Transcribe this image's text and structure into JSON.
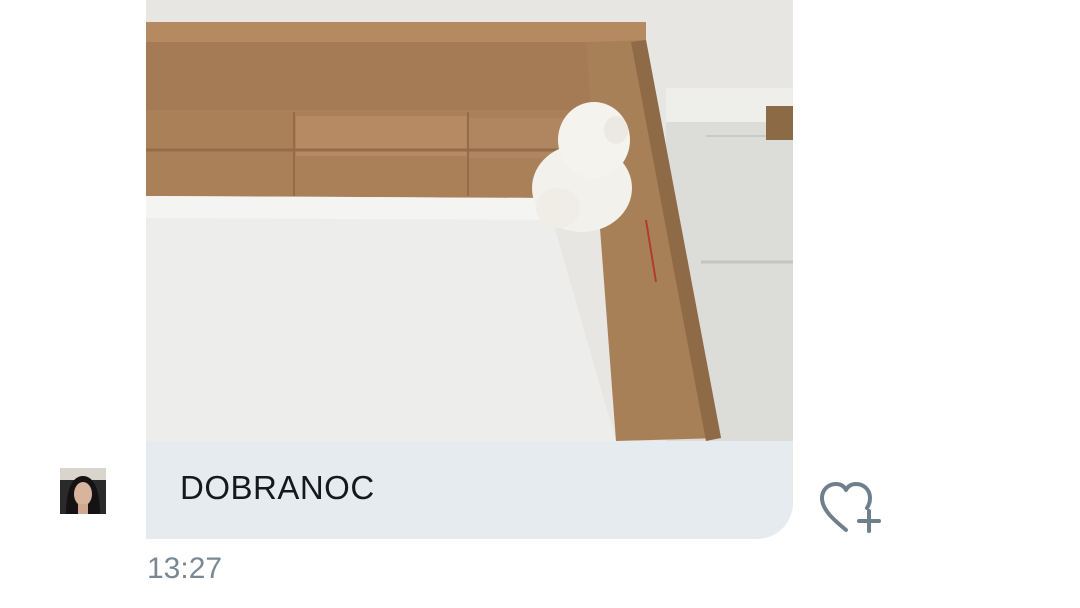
{
  "message": {
    "text": "DOBRANOC",
    "time": "13:27"
  },
  "photo": {
    "kind": "image-attachment"
  },
  "actions": {
    "like_icon": "heart-plus-icon"
  },
  "colors": {
    "bubble": "#e6ebef",
    "time": "#7a8894",
    "icon": "#6f7f8c"
  }
}
